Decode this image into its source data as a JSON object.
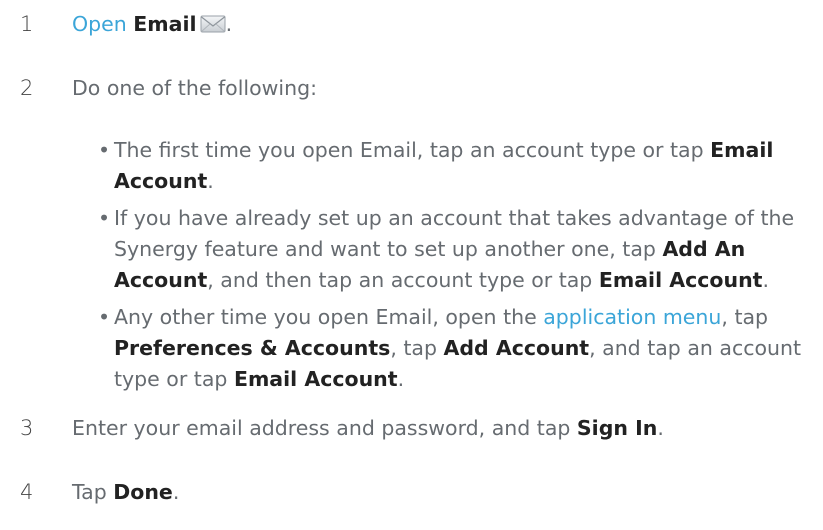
{
  "steps": {
    "s1": {
      "number": "1",
      "link": "Open",
      "bold": "Email",
      "tail": "."
    },
    "s2": {
      "number": "2",
      "text": "Do one of the following:"
    },
    "bullets": {
      "b1": {
        "t1": "The first time you open Email, tap an account type or tap ",
        "bold1": "Email Account",
        "t2": "."
      },
      "b2": {
        "t1": "If you have already set up an account that takes advantage of the Synergy feature and want to set up another one, tap ",
        "bold1": "Add An Account",
        "t2": ", and then tap an account type or tap ",
        "bold2": "Email Account",
        "t3": "."
      },
      "b3": {
        "t1": "Any other time you open Email, open the ",
        "link1": "application menu",
        "t2": ", tap ",
        "bold1": "Preferences & Accounts",
        "t3": ", tap ",
        "bold2": "Add Account",
        "t4": ", and tap an account type or tap ",
        "bold3": "Email Account",
        "t5": "."
      }
    },
    "s3": {
      "number": "3",
      "t1": "Enter your email address and password, and tap ",
      "bold": "Sign In",
      "t2": "."
    },
    "s4": {
      "number": "4",
      "t1": "Tap ",
      "bold": "Done",
      "t2": "."
    }
  },
  "colors": {
    "link": "#3ba5d8",
    "body_text": "#666b70",
    "bold_text": "#222222"
  },
  "icons": {
    "email": "envelope-icon"
  }
}
